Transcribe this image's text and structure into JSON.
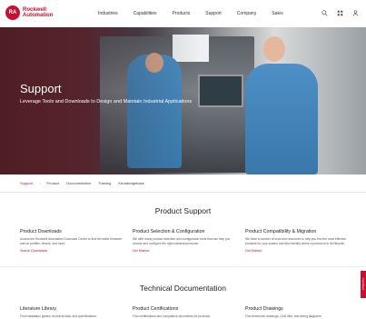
{
  "brand": {
    "badge": "RA",
    "line1": "Rockwell",
    "line2": "Automation"
  },
  "nav": [
    "Industries",
    "Capabilities",
    "Products",
    "Support",
    "Company",
    "Sales"
  ],
  "icons": [
    "search-icon",
    "grid-icon",
    "user-icon"
  ],
  "hero": {
    "title": "Support",
    "subtitle": "Leverage Tools and Downloads to Design and Maintain Industrial Applications"
  },
  "tabs": [
    "Support",
    "Product",
    "Documentation",
    "Training",
    "Knowledgebase"
  ],
  "product_support": {
    "title": "Product Support",
    "columns": [
      {
        "heading": "Product Downloads",
        "text": "Access the Rockwell Automation Download Center to find the latest firmware, add-on profiles, drivers, and more.",
        "link": "Search Downloads"
      },
      {
        "heading": "Product Selection & Configuration",
        "text": "We offer many product selection and configuration tools that can help you choose and configure the right industrial products.",
        "link": "Get Started"
      },
      {
        "heading": "Product Compatibility & Migration",
        "text": "We have a number of tools and resources to help you find the most effective products for your system and also identify where a product is in its lifecycle.",
        "link": "Get Started"
      }
    ]
  },
  "technical_documentation": {
    "title": "Technical Documentation",
    "columns": [
      {
        "heading": "Literature Library",
        "text": "Find installation guides, technical data, and specifications."
      },
      {
        "heading": "Product Certifications",
        "text": "Find certifications and compliance documents for products."
      },
      {
        "heading": "Product Drawings",
        "text": "Find dimension drawings, CAD files, and wiring diagrams."
      }
    ]
  },
  "feedback": "Feedback"
}
